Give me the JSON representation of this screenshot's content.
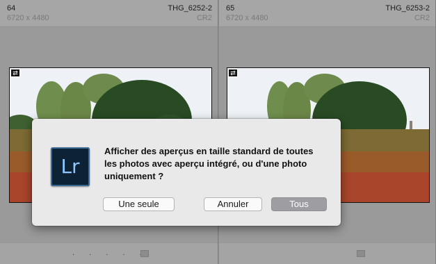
{
  "grid": {
    "cells": [
      {
        "index": "64",
        "dimensions": "6720 x 4480",
        "filename": "THG_6252-2",
        "extension": "CR2",
        "badge_icon": "rotate-icon",
        "footer_dots": ". . . . ."
      },
      {
        "index": "65",
        "dimensions": "6720 x 4480",
        "filename": "THG_6253-2",
        "extension": "CR2",
        "badge_icon": "rotate-icon",
        "footer_dots": ""
      }
    ]
  },
  "dialog": {
    "app_icon_label": "Lr",
    "message_lines": [
      "Afficher des aperçus en taille standard de toutes",
      "les photos avec aperçu intégré, ou d'une photo",
      "uniquement ?"
    ],
    "buttons": {
      "one": "Une seule",
      "cancel": "Annuler",
      "all": "Tous"
    }
  },
  "colors": {
    "dialog_background": "#e9e9e9",
    "default_button": "#9d9da2",
    "app_icon_background": "#0e2236",
    "app_icon_text": "#8fc6ff"
  }
}
